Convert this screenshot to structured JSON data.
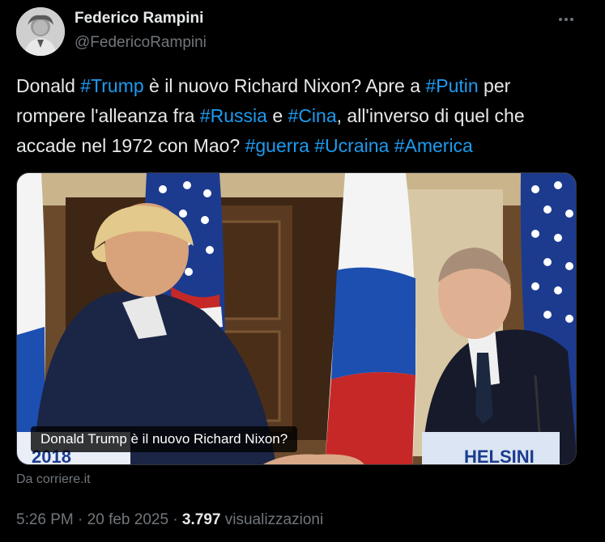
{
  "author": {
    "display_name": "Federico Rampini",
    "handle": "@FedericoRampini"
  },
  "tweet": {
    "segments": [
      {
        "text": "Donald ",
        "hashtag": false
      },
      {
        "text": "#Trump",
        "hashtag": true
      },
      {
        "text": " è il nuovo Richard Nixon? Apre a ",
        "hashtag": false
      },
      {
        "text": "#Putin",
        "hashtag": true
      },
      {
        "text": " per rompere l'alleanza fra ",
        "hashtag": false
      },
      {
        "text": "#Russia",
        "hashtag": true
      },
      {
        "text": " e ",
        "hashtag": false
      },
      {
        "text": "#Cina",
        "hashtag": true
      },
      {
        "text": ", all'inverso di quel che accade nel 1972 con Mao? ",
        "hashtag": false
      },
      {
        "text": "#guerra",
        "hashtag": true
      },
      {
        "text": " ",
        "hashtag": false
      },
      {
        "text": "#Ucraina",
        "hashtag": true
      },
      {
        "text": " ",
        "hashtag": false
      },
      {
        "text": "#America",
        "hashtag": true
      }
    ]
  },
  "media": {
    "caption": "Donald Trump è il nuovo Richard Nixon?",
    "sign_left": "2018",
    "sign_right": "HELSINI",
    "source": "Da corriere.it"
  },
  "meta": {
    "time": "5:26 PM",
    "separator": "·",
    "date": "20 feb 2025",
    "views_count": "3.797",
    "views_label": "visualizzazioni"
  },
  "colors": {
    "background": "#000000",
    "text": "#e7e9ea",
    "secondary": "#71767b",
    "link": "#1d9bf0"
  },
  "icons": {
    "more": "more-horizontal-icon"
  }
}
